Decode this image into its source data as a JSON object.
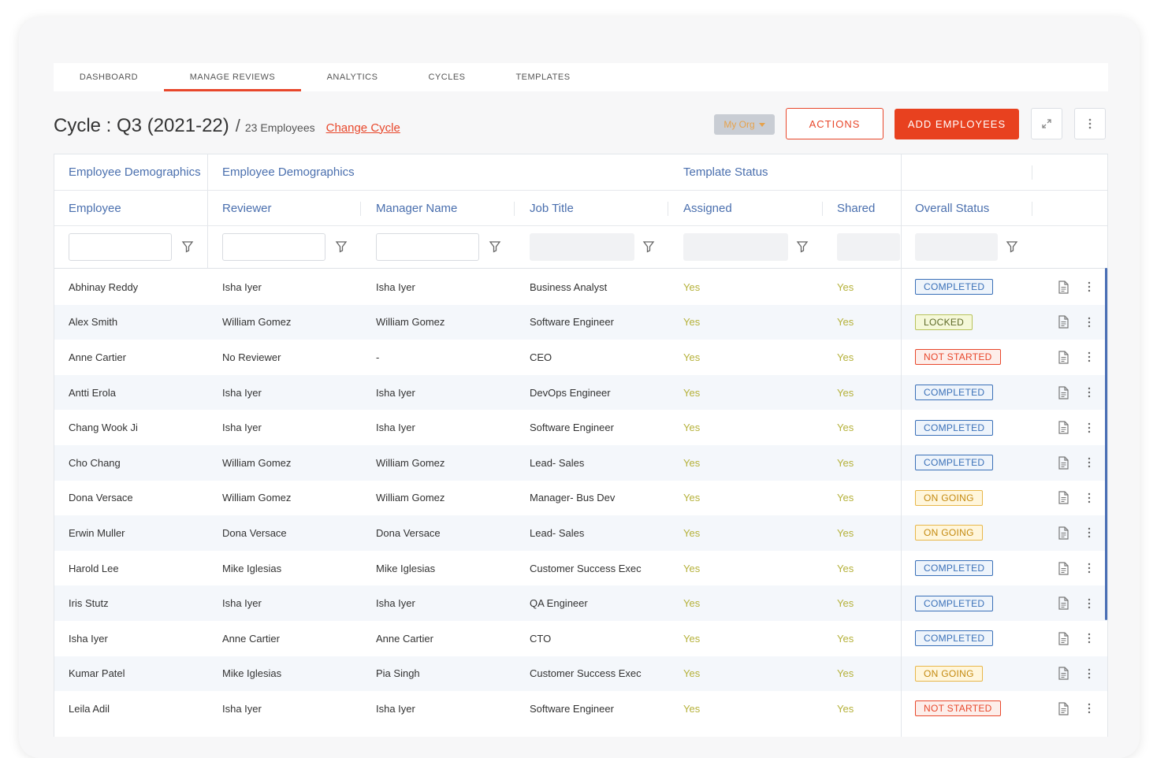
{
  "tabs": [
    {
      "label": "DASHBOARD",
      "active": false
    },
    {
      "label": "MANAGE REVIEWS",
      "active": true
    },
    {
      "label": "ANALYTICS",
      "active": false
    },
    {
      "label": "CYCLES",
      "active": false
    },
    {
      "label": "TEMPLATES",
      "active": false
    }
  ],
  "header": {
    "title": "Cycle : Q3 (2021-22)",
    "slash": "/",
    "employee_count": "23 Employees",
    "change_cycle": "Change Cycle",
    "org_filter": "My Org",
    "actions_label": "ACTIONS",
    "add_employees_label": "ADD EMPLOYEES"
  },
  "colors": {
    "accent": "#e8472b",
    "header_text": "#4a6fae",
    "yes": "#b5b13a",
    "completed": "#3a70b8",
    "locked": "#b8c25a",
    "not_started": "#e8472b",
    "on_going": "#e8b74a"
  },
  "table": {
    "groups": [
      "Employee Demographics",
      "Employee Demographics",
      "Template Status"
    ],
    "columns": [
      "Employee",
      "Reviewer",
      "Manager Name",
      "Job Title",
      "Assigned",
      "Shared",
      "Overall Status"
    ],
    "rows": [
      {
        "employee": "Abhinay Reddy",
        "reviewer": "Isha Iyer",
        "manager": "Isha Iyer",
        "job": "Business Analyst",
        "assigned": "Yes",
        "shared": "Yes",
        "status": "COMPLETED",
        "status_kind": "completed"
      },
      {
        "employee": "Alex Smith",
        "reviewer": "William Gomez",
        "manager": "William Gomez",
        "job": "Software Engineer",
        "assigned": "Yes",
        "shared": "Yes",
        "status": "LOCKED",
        "status_kind": "locked"
      },
      {
        "employee": "Anne Cartier",
        "reviewer": "No Reviewer",
        "manager": "-",
        "job": "CEO",
        "assigned": "Yes",
        "shared": "Yes",
        "status": "NOT STARTED",
        "status_kind": "notstarted"
      },
      {
        "employee": "Antti Erola",
        "reviewer": "Isha Iyer",
        "manager": "Isha Iyer",
        "job": "DevOps Engineer",
        "assigned": "Yes",
        "shared": "Yes",
        "status": "COMPLETED",
        "status_kind": "completed"
      },
      {
        "employee": "Chang Wook Ji",
        "reviewer": "Isha Iyer",
        "manager": "Isha Iyer",
        "job": "Software Engineer",
        "assigned": "Yes",
        "shared": "Yes",
        "status": "COMPLETED",
        "status_kind": "completed"
      },
      {
        "employee": "Cho Chang",
        "reviewer": "William Gomez",
        "manager": "William Gomez",
        "job": "Lead- Sales",
        "assigned": "Yes",
        "shared": "Yes",
        "status": "COMPLETED",
        "status_kind": "completed"
      },
      {
        "employee": "Dona Versace",
        "reviewer": "William Gomez",
        "manager": "William Gomez",
        "job": "Manager- Bus Dev",
        "assigned": "Yes",
        "shared": "Yes",
        "status": "ON GOING",
        "status_kind": "ongoing"
      },
      {
        "employee": "Erwin Muller",
        "reviewer": "Dona Versace",
        "manager": "Dona Versace",
        "job": "Lead- Sales",
        "assigned": "Yes",
        "shared": "Yes",
        "status": "ON GOING",
        "status_kind": "ongoing"
      },
      {
        "employee": "Harold Lee",
        "reviewer": "Mike Iglesias",
        "manager": "Mike Iglesias",
        "job": "Customer Success Exec",
        "assigned": "Yes",
        "shared": "Yes",
        "status": "COMPLETED",
        "status_kind": "completed"
      },
      {
        "employee": "Iris Stutz",
        "reviewer": "Isha Iyer",
        "manager": "Isha Iyer",
        "job": "QA Engineer",
        "assigned": "Yes",
        "shared": "Yes",
        "status": "COMPLETED",
        "status_kind": "completed"
      },
      {
        "employee": "Isha Iyer",
        "reviewer": "Anne Cartier",
        "manager": "Anne Cartier",
        "job": "CTO",
        "assigned": "Yes",
        "shared": "Yes",
        "status": "COMPLETED",
        "status_kind": "completed"
      },
      {
        "employee": "Kumar Patel",
        "reviewer": "Mike Iglesias",
        "manager": "Pia Singh",
        "job": "Customer Success Exec",
        "assigned": "Yes",
        "shared": "Yes",
        "status": "ON GOING",
        "status_kind": "ongoing"
      },
      {
        "employee": "Leila Adil",
        "reviewer": "Isha Iyer",
        "manager": "Isha Iyer",
        "job": "Software Engineer",
        "assigned": "Yes",
        "shared": "Yes",
        "status": "NOT STARTED",
        "status_kind": "notstarted"
      }
    ]
  }
}
